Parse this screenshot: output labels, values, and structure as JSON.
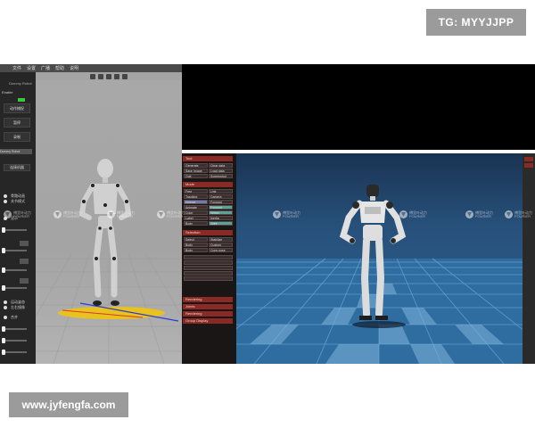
{
  "watermark_tag": "TG: MYYJJPP",
  "site_url": "www.jyfengfa.com",
  "left_app": {
    "menu": [
      "文件",
      "设置",
      "广播",
      "帮助",
      "说明"
    ],
    "panel": {
      "toggle_label": "Enable",
      "buttons": [
        "动作捕捉",
        "暂停",
        "录制"
      ],
      "field_text": "Dummy Robot",
      "small_button": "连接机器",
      "radio_labels": [
        "骨骼动画",
        "关节模式",
        "显示",
        "运动姿态",
        "左右镜像",
        "合并"
      ]
    }
  },
  "right_app": {
    "panel": {
      "headers": [
        "Tool",
        "Mode",
        "Selection",
        "Rendering",
        "Joints",
        "Rendering",
        "Group Display"
      ],
      "cells_top": [
        [
          "Generate",
          "Clear data"
        ],
        [
          "Save Image",
          "Load data"
        ],
        [
          "Quit",
          "Screenshot"
        ]
      ],
      "cells_mode": [
        [
          "Free",
          "Link"
        ],
        [
          "Tracking",
          "Camera"
        ],
        [
          "Inverse",
          "Forward"
        ],
        [
          "Animate",
          "Forward"
        ]
      ],
      "cells_props": [
        [
          "Color",
          "Vertex"
        ],
        [
          "Label",
          "Inertia"
        ],
        [
          "Body",
          "Joint"
        ]
      ],
      "cells_sel": [
        [
          "Select",
          "Stabilize"
        ],
        [
          "Body",
          "Custom"
        ],
        [
          "Body",
          "Copy pose"
        ]
      ]
    }
  },
  "watermark_text": [
    "傅里叶动力",
    "FOURIER"
  ]
}
